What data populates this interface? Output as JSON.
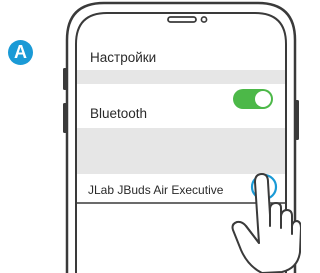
{
  "step_marker": "A",
  "screen": {
    "settings_title": "Настройки",
    "bluetooth_label": "Bluetooth",
    "bluetooth_on": true,
    "device_name": "JLab JBuds Air Executive"
  },
  "icons": {
    "info": "info-icon",
    "hand": "pointing-hand-icon",
    "toggle": "toggle-switch-icon"
  },
  "colors": {
    "accent_blue": "#1a9ad6",
    "toggle_green": "#4cb848",
    "section_gray": "#e6e6e6",
    "outline": "#3a3a3a"
  }
}
